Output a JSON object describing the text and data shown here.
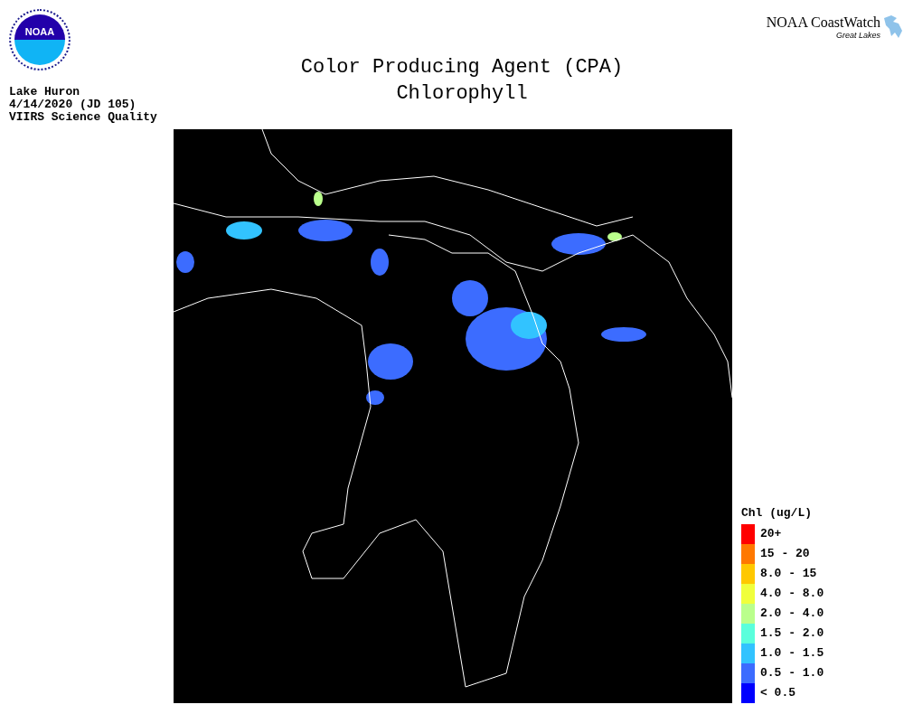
{
  "logo": {
    "text": "NOAA"
  },
  "brand": {
    "name": "NOAA CoastWatch",
    "subtitle": "Great Lakes"
  },
  "title": [
    "Color Producing Agent (CPA)",
    "Chlorophyll"
  ],
  "info": [
    "Lake Huron",
    "4/14/2020 (JD 105)",
    "VIIRS Science Quality"
  ],
  "legend": {
    "title": "Chl (ug/L)",
    "items": [
      {
        "label": "20+",
        "color": "#ff0000"
      },
      {
        "label": "15 - 20",
        "color": "#ff7800"
      },
      {
        "label": "8.0 - 15",
        "color": "#ffc800"
      },
      {
        "label": "4.0 - 8.0",
        "color": "#f0ff3c"
      },
      {
        "label": "2.0 - 4.0",
        "color": "#baff8c"
      },
      {
        "label": "1.5 - 2.0",
        "color": "#5affdc"
      },
      {
        "label": "1.0 - 1.5",
        "color": "#32c3ff"
      },
      {
        "label": "0.5 - 1.0",
        "color": "#3c6cff"
      },
      {
        "label": "< 0.5",
        "color": "#0000ff"
      }
    ]
  }
}
